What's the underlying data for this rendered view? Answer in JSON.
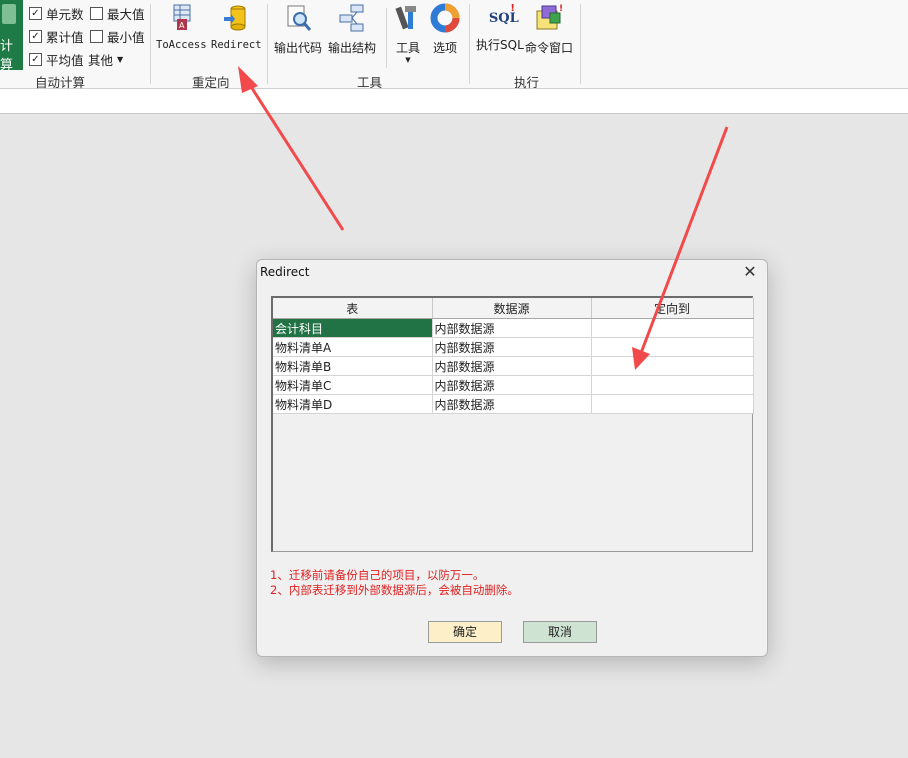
{
  "ribbon": {
    "big_button_label": "计算",
    "auto_calc": {
      "items": [
        {
          "label": "单元数",
          "checked": true
        },
        {
          "label": "最大值",
          "checked": false
        },
        {
          "label": "累计值",
          "checked": true
        },
        {
          "label": "最小值",
          "checked": false
        },
        {
          "label": "平均值",
          "checked": true
        }
      ],
      "other_label": "其他",
      "group_label": "自动计算"
    },
    "redirect_group": {
      "to_access": "ToAccess",
      "redirect": "Redirect",
      "group_label": "重定向"
    },
    "tools_group": {
      "export_code": "输出代码",
      "export_structure": "输出结构",
      "tools": "工具",
      "options": "选项",
      "group_label": "工具"
    },
    "exec_group": {
      "exec_sql": "执行SQL",
      "command_window": "命令窗口",
      "sql_icon_text": "SQL",
      "group_label": "执行"
    }
  },
  "dialog": {
    "title": "Redirect",
    "close_glyph": "✕",
    "columns": [
      "表",
      "数据源",
      "定向到"
    ],
    "rows": [
      [
        "会计科目",
        "内部数据源",
        ""
      ],
      [
        "物料清单A",
        "内部数据源",
        ""
      ],
      [
        "物料清单B",
        "内部数据源",
        ""
      ],
      [
        "物料清单C",
        "内部数据源",
        ""
      ],
      [
        "物料清单D",
        "内部数据源",
        ""
      ]
    ],
    "selected_row": 0,
    "notes": [
      "1、迁移前请备份自己的项目，以防万一。",
      "2、内部表迁移到外部数据源后，会被自动删除。"
    ],
    "ok_label": "确定",
    "cancel_label": "取消"
  },
  "colors": {
    "selection": "#217346",
    "note_text": "#e02020",
    "arrow": "#f24a4a",
    "ok_button": "#fdf0c8",
    "cancel_button": "#cfe3d3"
  }
}
